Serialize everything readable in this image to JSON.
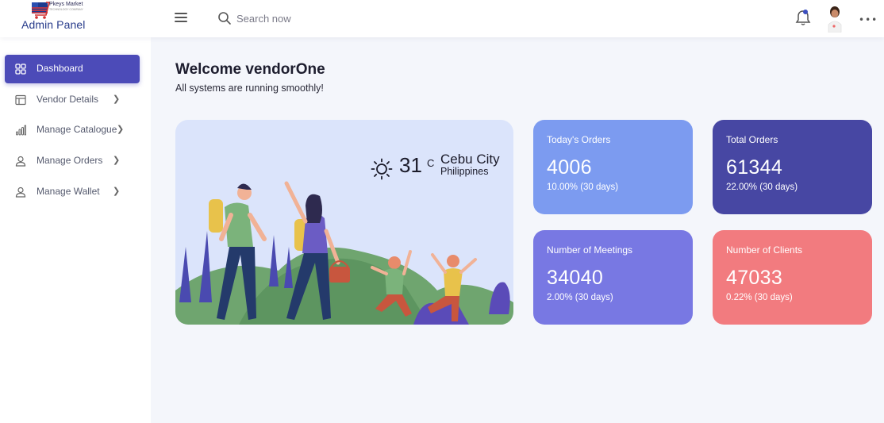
{
  "header": {
    "logo_text": "Pkeys Market",
    "logo_subtext": "TECHNOLOGY COMPANY",
    "brand_title": "Admin Panel",
    "menu_icon": "hamburger-icon",
    "search_placeholder": "Search now",
    "notification_icon": "bell-icon",
    "more_icon": "ellipsis-icon"
  },
  "sidebar": {
    "items": [
      {
        "label": "Dashboard",
        "icon": "grid-icon",
        "active": true
      },
      {
        "label": "Vendor Details",
        "icon": "table-icon"
      },
      {
        "label": "Manage Catalogue",
        "icon": "bar-chart-icon"
      },
      {
        "label": "Manage Orders",
        "icon": "user-icon"
      },
      {
        "label": "Manage Wallet",
        "icon": "user-icon"
      }
    ]
  },
  "main": {
    "welcome_title": "Welcome vendorOne",
    "welcome_subtitle": "All systems are running smoothly!",
    "weather": {
      "temperature": "31",
      "unit": "C",
      "city": "Cebu City",
      "country": "Philippines",
      "icon": "sun-icon"
    },
    "stats": [
      {
        "label": "Today's Orders",
        "value": "4006",
        "change": "10.00% (30 days)",
        "color": "#7c9bf0"
      },
      {
        "label": "Total Orders",
        "value": "61344",
        "change": "22.00% (30 days)",
        "color": "#4747a3"
      },
      {
        "label": "Number of Meetings",
        "value": "34040",
        "change": "2.00% (30 days)",
        "color": "#7878e3"
      },
      {
        "label": "Number of Clients",
        "value": "47033",
        "change": "0.22% (30 days)",
        "color": "#f27b7f"
      }
    ]
  },
  "colors": {
    "accent": "#4c4bb8",
    "background": "#f4f6fb",
    "weather_card": "#dbe4fb"
  }
}
